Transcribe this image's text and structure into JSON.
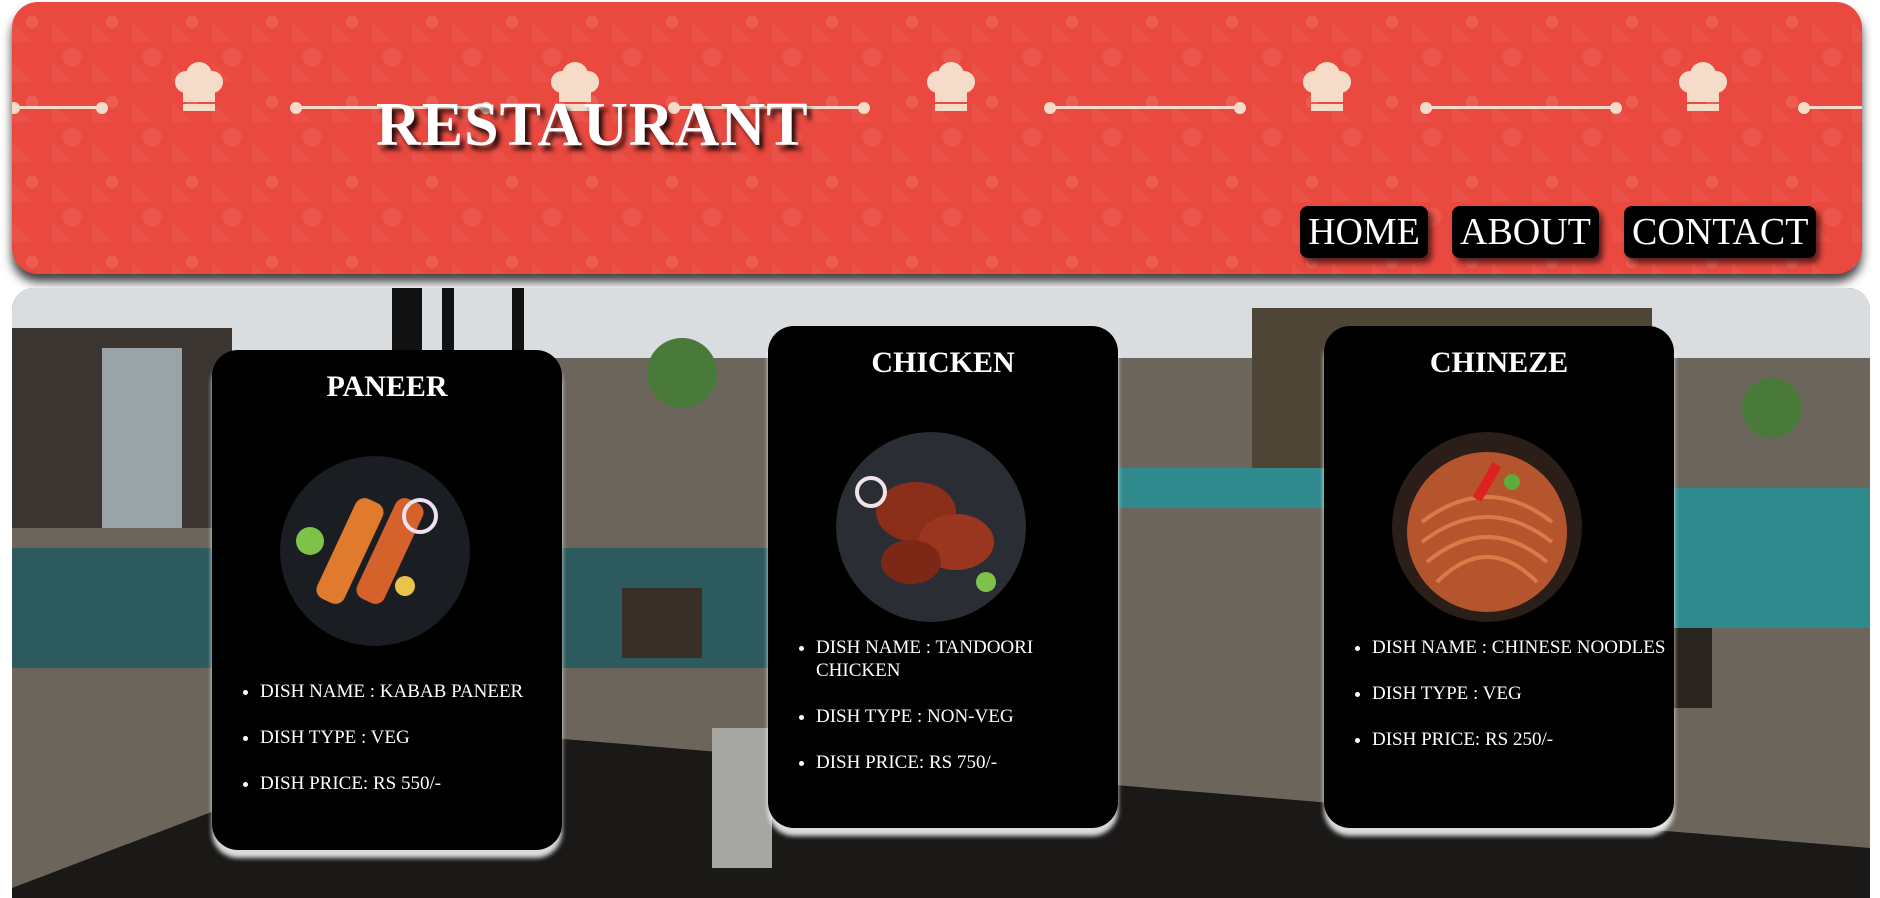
{
  "header": {
    "title": "RESTAURANT",
    "nav": [
      {
        "label": "HOME"
      },
      {
        "label": "ABOUT"
      },
      {
        "label": "CONTACT"
      }
    ]
  },
  "colors": {
    "header_background": "#e9493f",
    "decor": "#f4dcc8",
    "card_background": "#000000",
    "card_text": "#ffffff"
  },
  "hero": {
    "background": "restaurant dining interior photo"
  },
  "dishes": [
    {
      "title": "PANEER",
      "image": "kabab-paneer-photo",
      "name": "DISH NAME : KABAB PANEER",
      "type": "DISH TYPE : VEG",
      "price": "DISH PRICE: RS 550/-"
    },
    {
      "title": "CHICKEN",
      "image": "tandoori-chicken-photo",
      "name": "DISH NAME : TANDOORI CHICKEN",
      "type": "DISH TYPE : NON-VEG",
      "price": "DISH PRICE: RS 750/-"
    },
    {
      "title": "CHINEZE",
      "image": "chinese-noodles-photo",
      "name": "DISH NAME : CHINESE NOODLES",
      "type": "DISH TYPE : VEG",
      "price": "DISH PRICE: RS 250/-"
    }
  ]
}
